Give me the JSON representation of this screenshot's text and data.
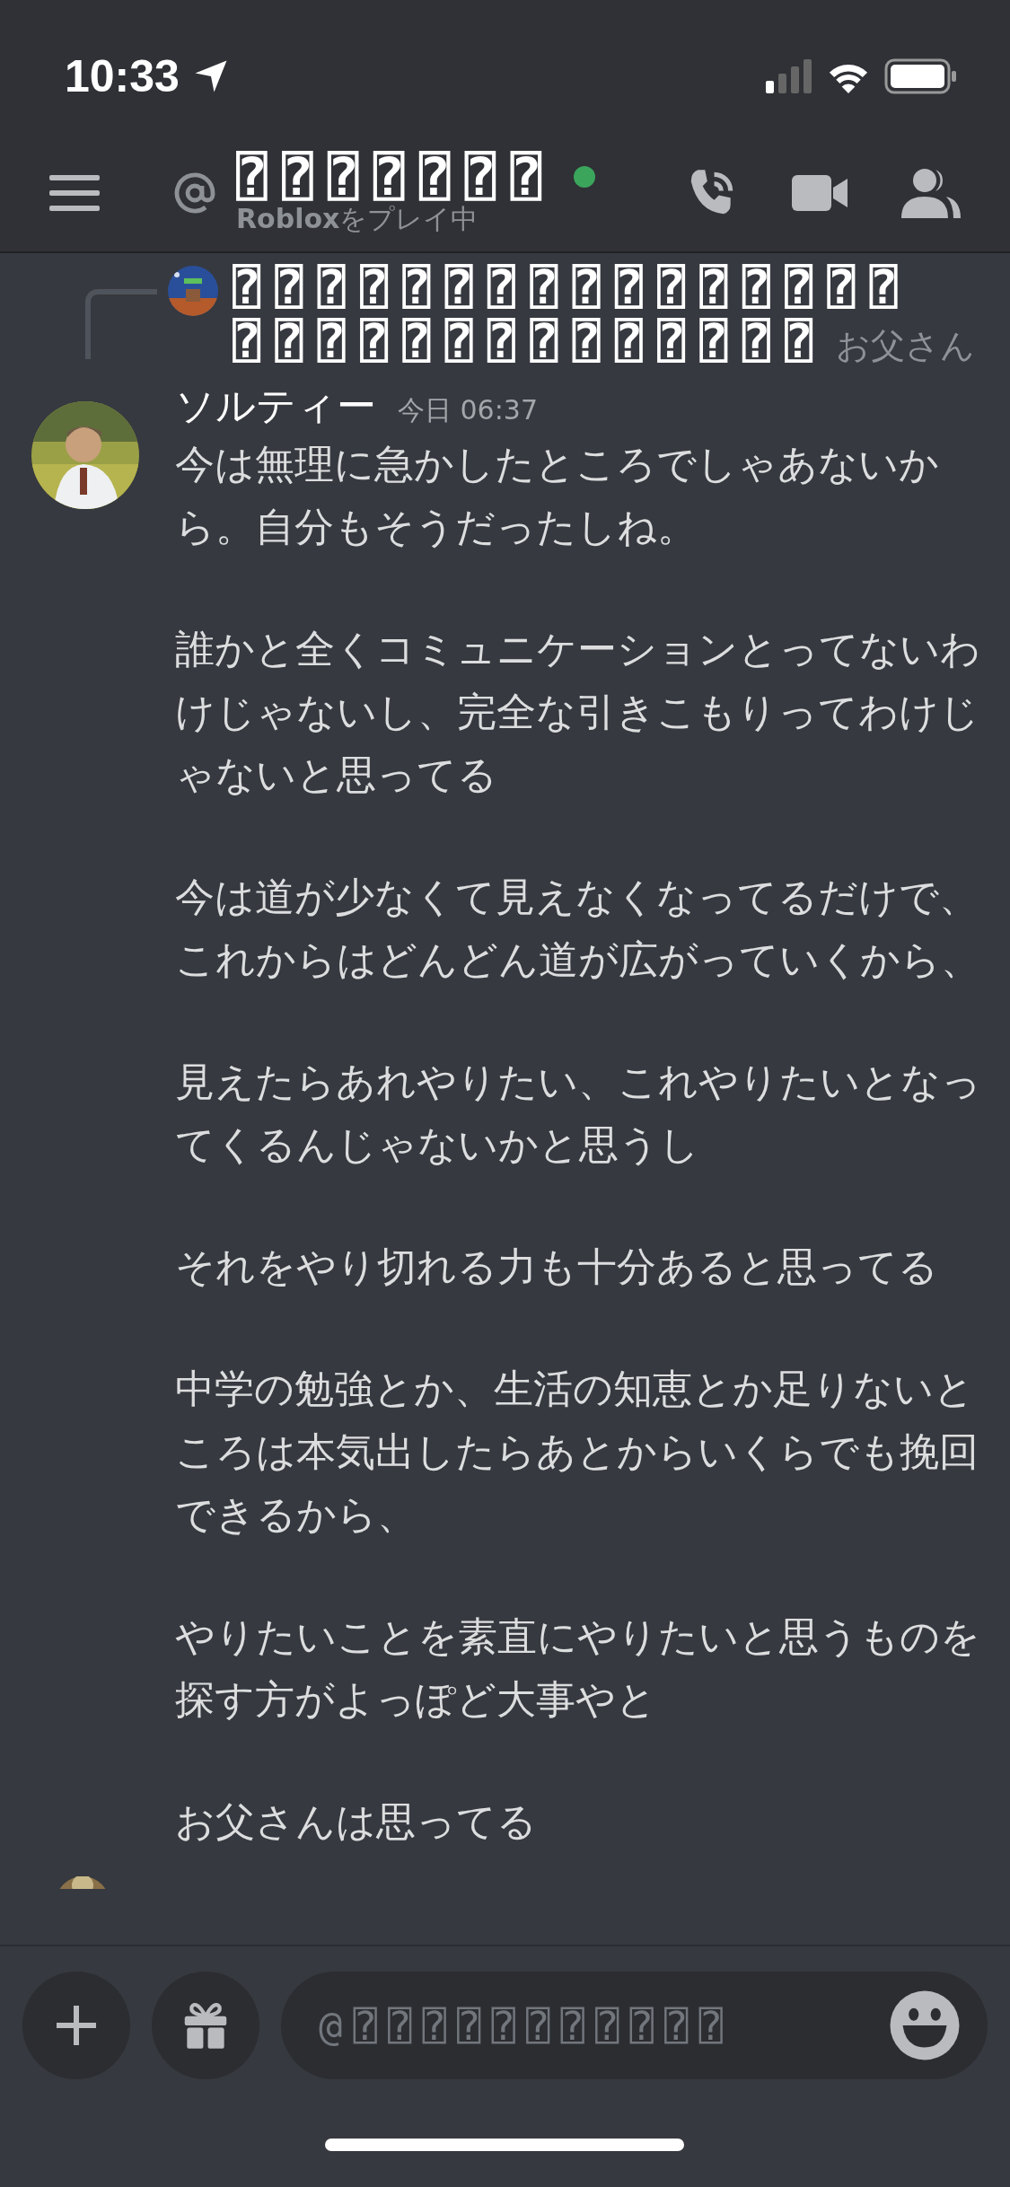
{
  "status_bar": {
    "time": "10:33"
  },
  "header": {
    "title": "⍰⍰⍰⍰⍰⍰⍰",
    "online": true,
    "activity": "**Roblox**をプレイ中"
  },
  "reply": {
    "text_lines": [
      "⍰⍰⍰⍰⍰⍰⍰⍰⍰⍰⍰⍰⍰⍰⍰⍰",
      "⍰⍰⍰⍰⍰⍰⍰⍰⍰⍰⍰⍰⍰⍰"
    ],
    "author": "お父さん"
  },
  "message": {
    "author": "ソルティー",
    "timestamp": "今日 06:37",
    "paragraphs": [
      "今は無理に急かしたところでしゃあないから。自分もそうだったしね。",
      "誰かと全くコミュニケーションとってないわけじゃないし、完全な引きこもりってわけじゃないと思ってる",
      "今は道が少なくて見えなくなってるだけで、これからはどんどん道が広がっていくから、",
      "見えたらあれやりたい、これやりたいとなってくるんじゃないかと思うし",
      "それをやり切れる力も十分あると思ってる",
      "中学の勉強とか、生活の知恵とか足りないところは本気出したらあとからいくらでも挽回できるから、",
      "やりたいことを素直にやりたいと思うものを探す方がよっぽど大事やと",
      "お父さんは思ってる"
    ]
  },
  "composer": {
    "placeholder": "@⍰⍰⍰⍰⍰⍰⍰⍰⍰⍰⍰"
  }
}
